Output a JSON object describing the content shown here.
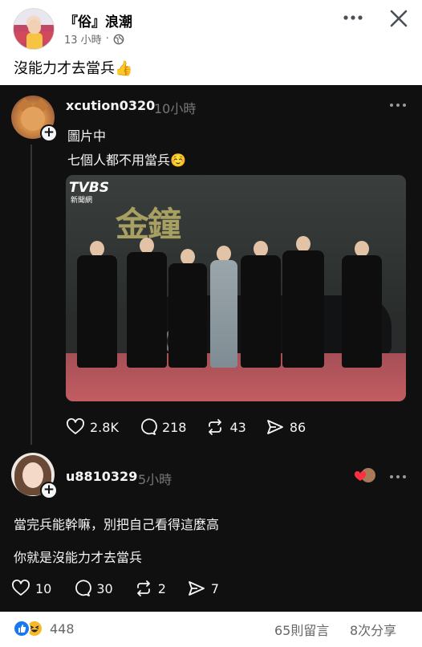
{
  "post": {
    "author": "『俗』浪潮",
    "time": "13 小時",
    "caption": "沒能力才去當兵👍",
    "icons": [
      "globe-icon",
      "more-icon",
      "close-icon"
    ]
  },
  "threads": {
    "first": {
      "username": "xcution0320",
      "time": "10小時",
      "lines": [
        "圖片中",
        "七個人都不用當兵☺️"
      ],
      "image_alt_visible": {
        "logo": "TVBS",
        "logo_sub": "新聞網",
        "big_chars": "金鐘"
      },
      "stats": {
        "likes": "2.8K",
        "comments": "218",
        "reposts": "43",
        "shares": "86"
      }
    },
    "reply": {
      "username": "u8810329",
      "time": "5小時",
      "lines": [
        "當完兵能幹嘛，別把自己看得這麼高",
        "你就是沒能力才去當兵"
      ],
      "stats": {
        "likes": "10",
        "comments": "30",
        "reposts": "2",
        "shares": "7"
      }
    }
  },
  "footer": {
    "reaction_count": "448",
    "comments": "65則留言",
    "shares": "8次分享"
  },
  "colors": {
    "threads_bg": "#101010",
    "threads_text": "#f3f5f7",
    "threads_muted": "#777777",
    "fb_meta": "#65676b",
    "like_blue": "#1877f2",
    "haha_yellow": "#f7b928",
    "carpet": "#c25d62"
  }
}
